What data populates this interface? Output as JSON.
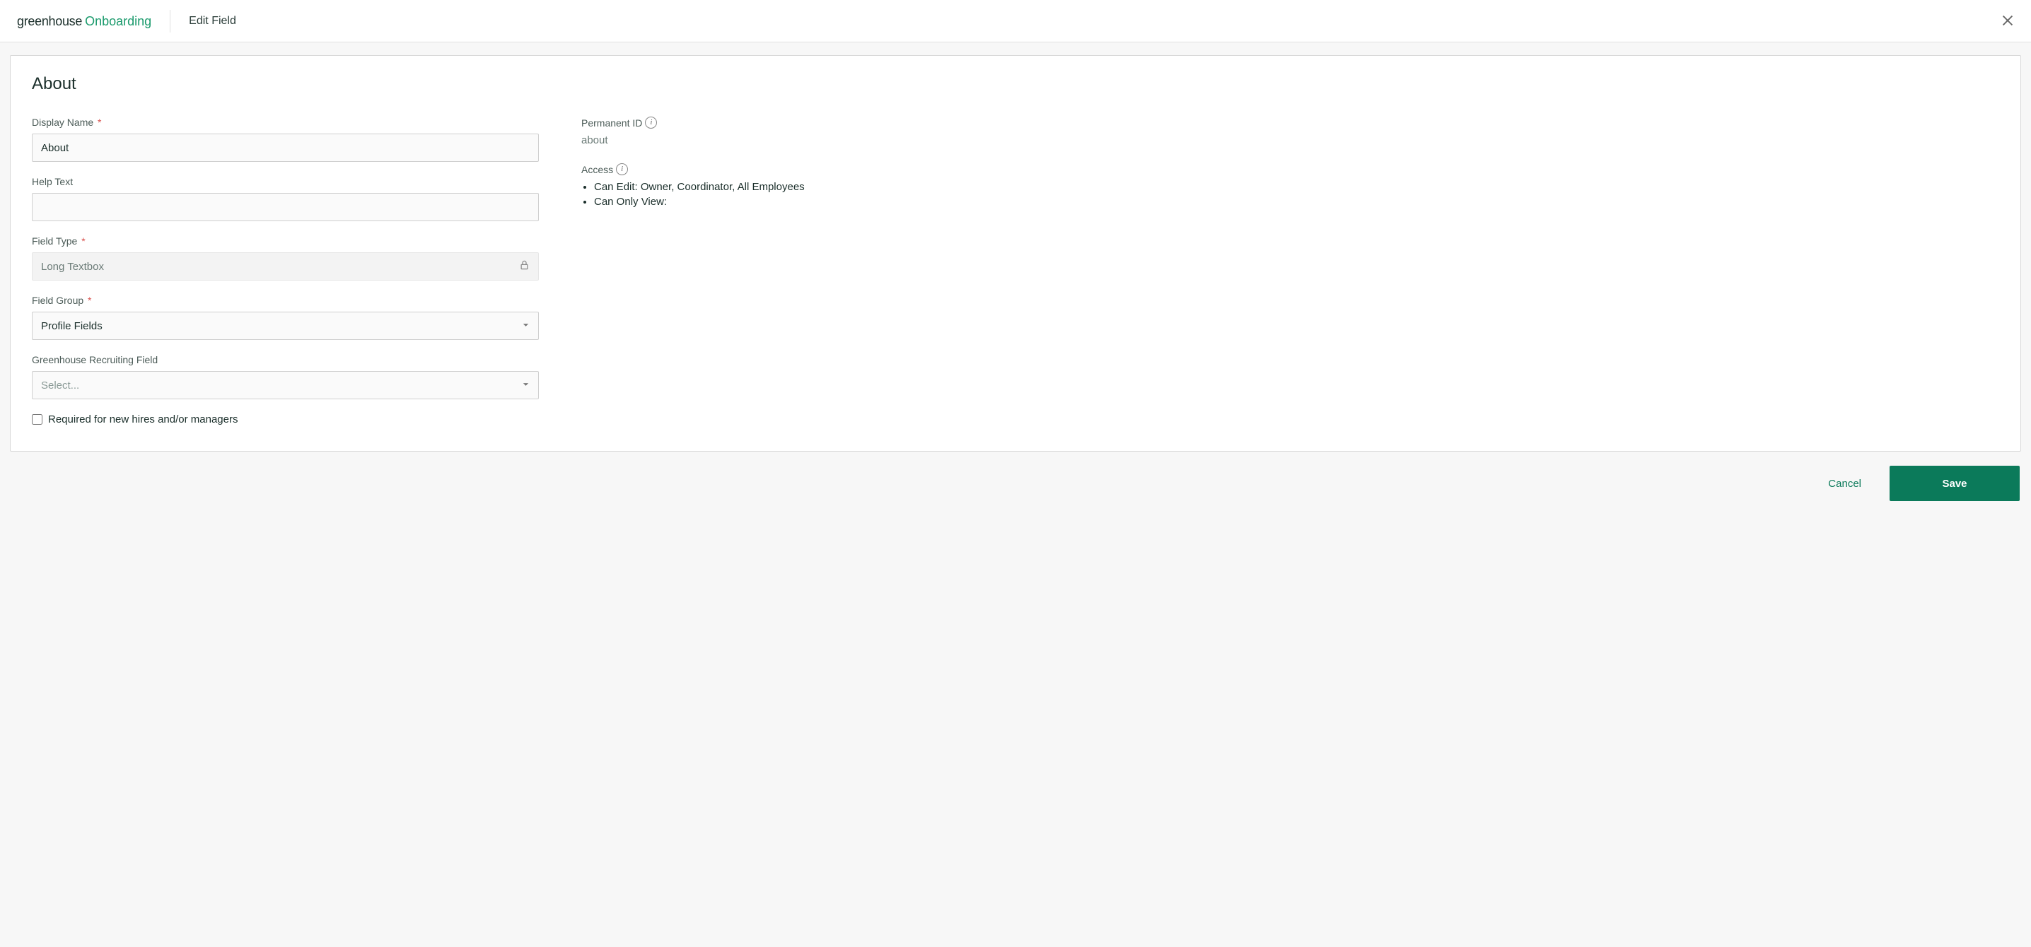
{
  "header": {
    "logo_primary": "greenhouse",
    "logo_secondary": "Onboarding",
    "title": "Edit Field"
  },
  "card": {
    "title": "About"
  },
  "form": {
    "display_name": {
      "label": "Display Name",
      "value": "About",
      "required": true
    },
    "help_text": {
      "label": "Help Text",
      "value": ""
    },
    "field_type": {
      "label": "Field Type",
      "value": "Long Textbox",
      "required": true,
      "locked": true
    },
    "field_group": {
      "label": "Field Group",
      "value": "Profile Fields",
      "required": true
    },
    "recruiting_field": {
      "label": "Greenhouse Recruiting Field",
      "placeholder": "Select..."
    },
    "required_checkbox": {
      "label": "Required for new hires and/or managers",
      "checked": false
    }
  },
  "side": {
    "permanent_id": {
      "label": "Permanent ID",
      "value": "about"
    },
    "access": {
      "label": "Access",
      "can_edit_label": "Can Edit:",
      "can_edit_value": "Owner, Coordinator, All Employees",
      "can_view_label": "Can Only View:",
      "can_view_value": ""
    }
  },
  "footer": {
    "cancel": "Cancel",
    "save": "Save"
  },
  "required_mark": "*"
}
